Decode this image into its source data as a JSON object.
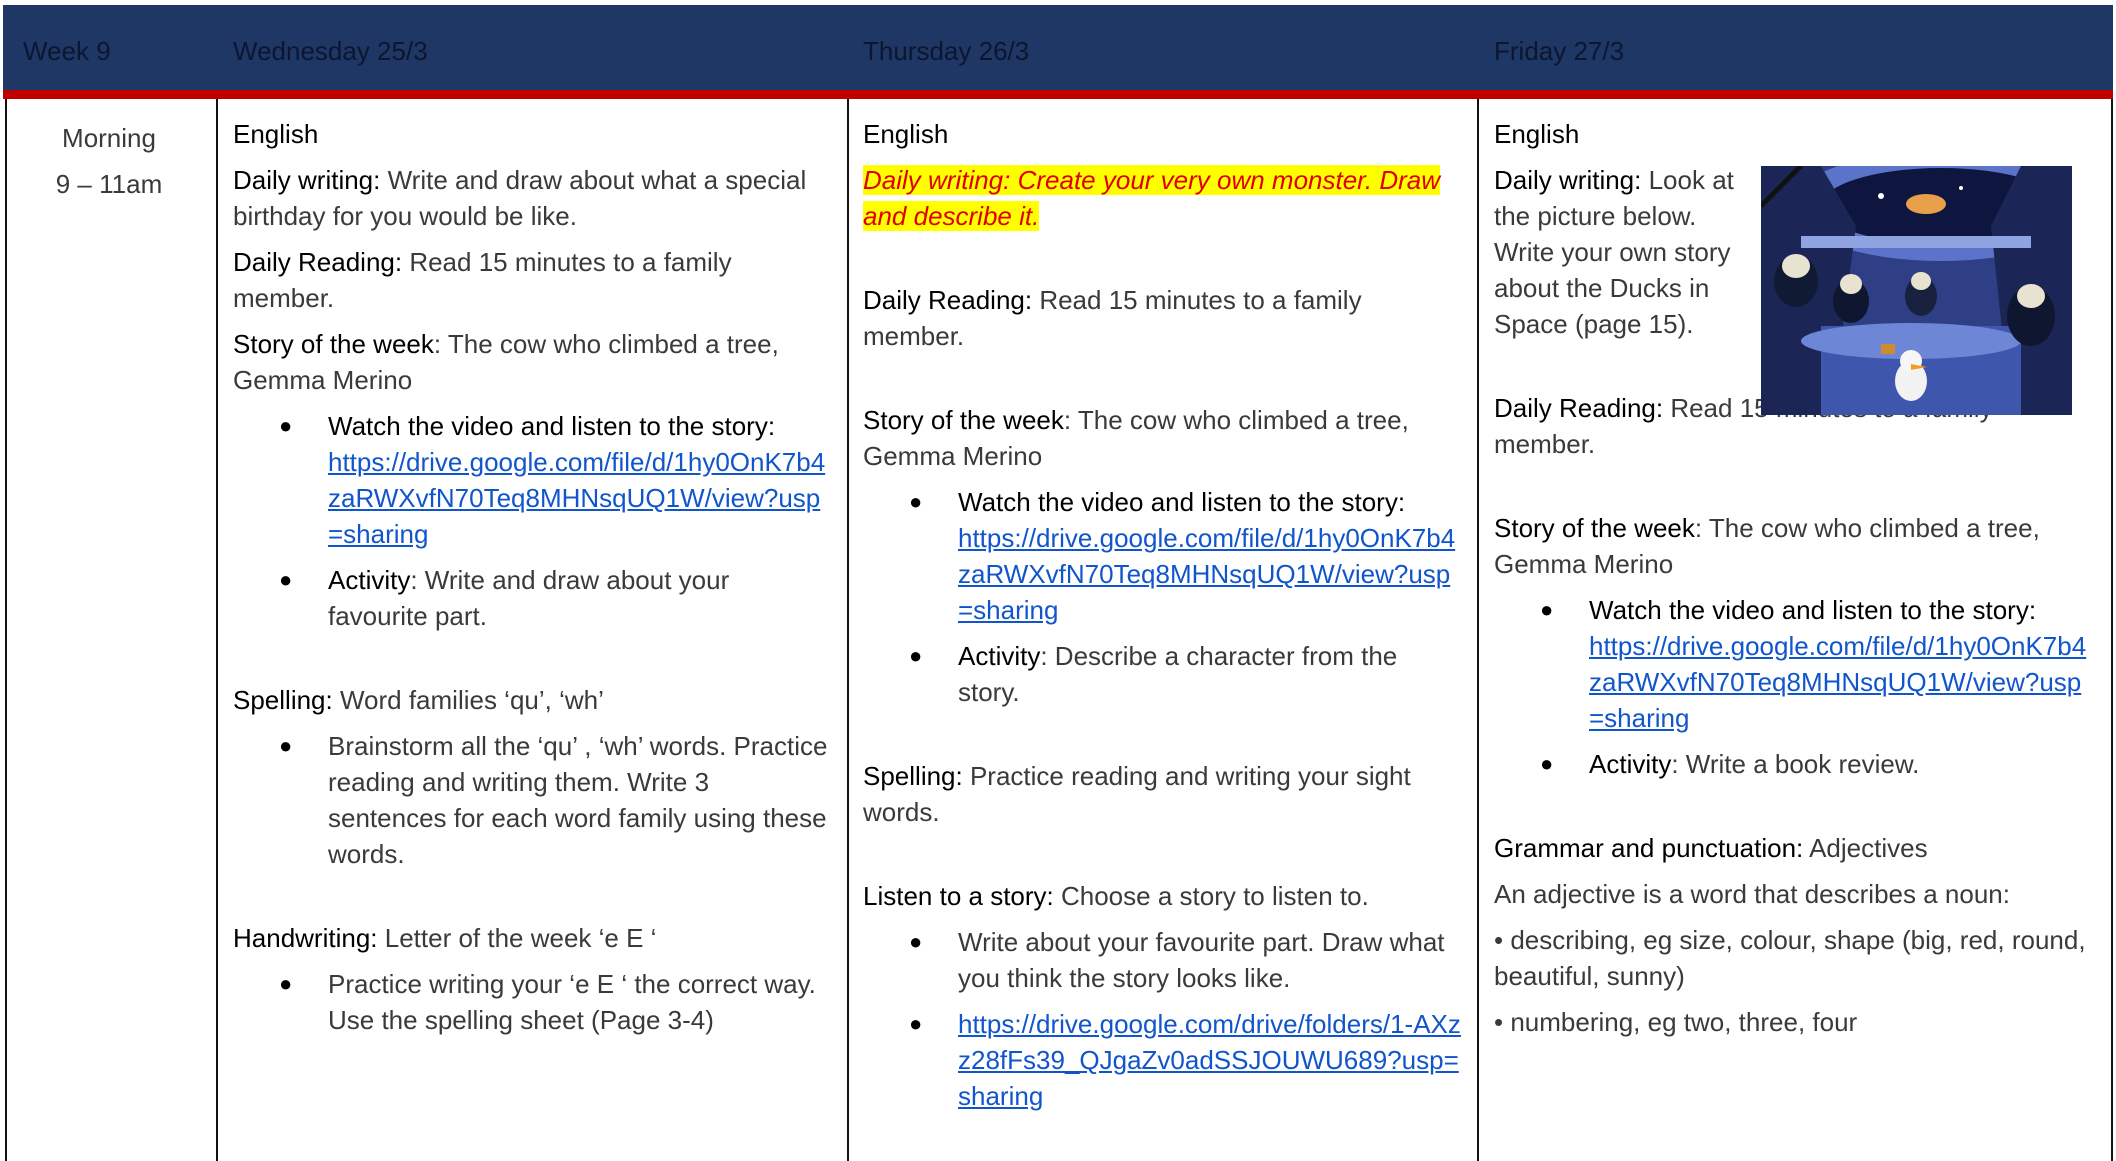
{
  "header": {
    "week": "Week 9",
    "day1": "Wednesday 25/3",
    "day2": "Thursday 26/3",
    "day3": "Friday 27/3"
  },
  "row": {
    "period": "Morning",
    "time": "9 – 11am"
  },
  "wednesday": {
    "subject": "English",
    "dw_label": "Daily writing:",
    "dw_text": " Write and draw about what a special birthday for you would be like.",
    "dr_label": "Daily Reading:",
    "dr_text": " Read 15 minutes to a family member.",
    "sw_label": "Story of the week",
    "sw_text": ": The cow who climbed a tree, Gemma Merino",
    "watch_label": "Watch the video and listen to the story:",
    "watch_link": "https://drive.google.com/file/d/1hy0OnK7b4zaRWXvfN70Teq8MHNsqUQ1W/view?usp=sharing",
    "activity_label": "Activity",
    "activity_text": ": Write and draw about your favourite part.",
    "sp_label": "Spelling:",
    "sp_text": " Word families ‘qu’, ‘wh’",
    "sp_bullet": "Brainstorm all the ‘qu’ , ‘wh’ words. Practice reading and writing them. Write 3 sentences for each word family using these words.",
    "hw_label": "Handwriting:",
    "hw_text": " Letter of the week ‘e E ‘",
    "hw_bullet": "Practice writing your ‘e E ‘ the correct way. Use the spelling sheet (Page 3-4)"
  },
  "thursday": {
    "subject": "English",
    "dw_label": "Daily writing:",
    "dw_text": " Create your very own monster. Draw and describe it.",
    "dr_label": "Daily Reading:",
    "dr_text": " Read 15 minutes to a family member.",
    "sw_label": "Story of the week",
    "sw_text": ": The cow who climbed a tree, Gemma Merino",
    "watch_label": "Watch the video and listen to the story:",
    "watch_link": "https://drive.google.com/file/d/1hy0OnK7b4zaRWXvfN70Teq8MHNsqUQ1W/view?usp=sharing",
    "activity_label": "Activity",
    "activity_text": ": Describe a character from the story.",
    "sp_label": "Spelling:",
    "sp_text": " Practice reading and writing your sight words.",
    "ls_label": "Listen to a story:",
    "ls_text": " Choose a story to listen to.",
    "ls_bullet": "Write about your favourite part. Draw what you think the story looks like.",
    "ls_link": "https://drive.google.com/drive/folders/1-AXzz28fFs39_QJgaZv0adSSJOUWU689?usp=sharing"
  },
  "friday": {
    "subject": "English",
    "dw_label": "Daily writing:",
    "dw_text": " Look at the picture below. Write your own story about the Ducks in Space (page 15).",
    "dr_label": "Daily Reading:",
    "dr_text": " Read 15 minutes to a family member.",
    "sw_label": "Story of the week",
    "sw_text": ": The cow who climbed a tree, Gemma Merino",
    "watch_label": "Watch the video and listen to the story:",
    "watch_link": "https://drive.google.com/file/d/1hy0OnK7b4zaRWXvfN70Teq8MHNsqUQ1W/view?usp=sharing",
    "activity_label": "Activity",
    "activity_text": ": Write a book review.",
    "gp_label": "Grammar and punctuation:",
    "gp_text": " Adjectives",
    "adj_def": "An adjective is a word that describes a noun:",
    "adj_1": "• describing, eg size, colour, shape (big, red, round, beautiful, sunny)",
    "adj_2": "• numbering, eg two, three, four"
  },
  "colors": {
    "header_bg": "#1e3764",
    "header_rule": "#c00000",
    "link": "#1155cc",
    "highlight": "#ffff00",
    "highlight_text": "#e00000"
  }
}
